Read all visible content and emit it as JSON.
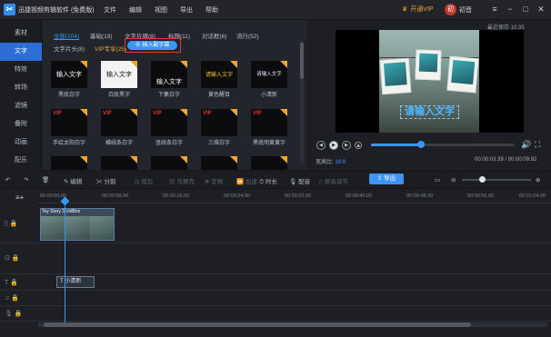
{
  "app": {
    "title": "迅捷视频剪辑软件 (免费版)",
    "menus": [
      "文件",
      "编辑",
      "视图",
      "导出",
      "帮助"
    ],
    "vip": "开通VIP",
    "avatar_char": "初",
    "username": "初音",
    "save_time": "最近保存 10:35"
  },
  "sidebar": [
    "素材",
    "文字",
    "特效",
    "转场",
    "滤镜",
    "叠附",
    "动画",
    "配乐"
  ],
  "panel": {
    "tabs": [
      "全部(104)",
      "基础(19)",
      "文字片摄(8)",
      "标题(11)",
      "对话框(6)",
      "流行(52)"
    ],
    "subtabs": [
      "文字片头(8)",
      "VIP专享(25)"
    ],
    "insert_button": "插入副字幕",
    "cards": [
      {
        "preview": "输入文字",
        "label": "黑底白字"
      },
      {
        "preview": "输入文字",
        "label": "白底黑字"
      },
      {
        "preview": "输入文字",
        "label": "下集白字"
      },
      {
        "preview": "请输入文字",
        "label": "黄色醒目"
      },
      {
        "preview": "请输入文字",
        "label": "小清新"
      },
      {
        "preview": "VIP",
        "label": "手绘太阳白字"
      },
      {
        "preview": "VIP",
        "label": "横线条白字"
      },
      {
        "preview": "VIP",
        "label": "竖线条白字"
      },
      {
        "preview": "VIP",
        "label": "三维白字"
      },
      {
        "preview": "VIP",
        "label": "黑底明黄黄字"
      }
    ]
  },
  "preview": {
    "subtitle_text": "请输入文字",
    "ratio_label": "宽高比:",
    "ratio_value": "16:9",
    "timecode": "00:00:03.39 / 00:00:09.92",
    "progress": 0.34
  },
  "toolbar": {
    "edit": "编辑",
    "split": "分割",
    "crop": "裁剪",
    "mosaic": "马赛克",
    "freeze": "定格",
    "speed": "加速",
    "duration": "时长",
    "dub": "配音",
    "voice": "原音调节",
    "export": "导出"
  },
  "timeline": {
    "ruler": [
      "00:00:00.00",
      "00:00:08.00",
      "00:00:16.00",
      "00:00:24.00",
      "00:00:32.00",
      "00:00:40.00",
      "00:00:48.00",
      "00:00:56.00",
      "00:01:04.00"
    ],
    "clip_label": "Toy Story 3 VidBox",
    "subtitle_clip": "小清新"
  }
}
